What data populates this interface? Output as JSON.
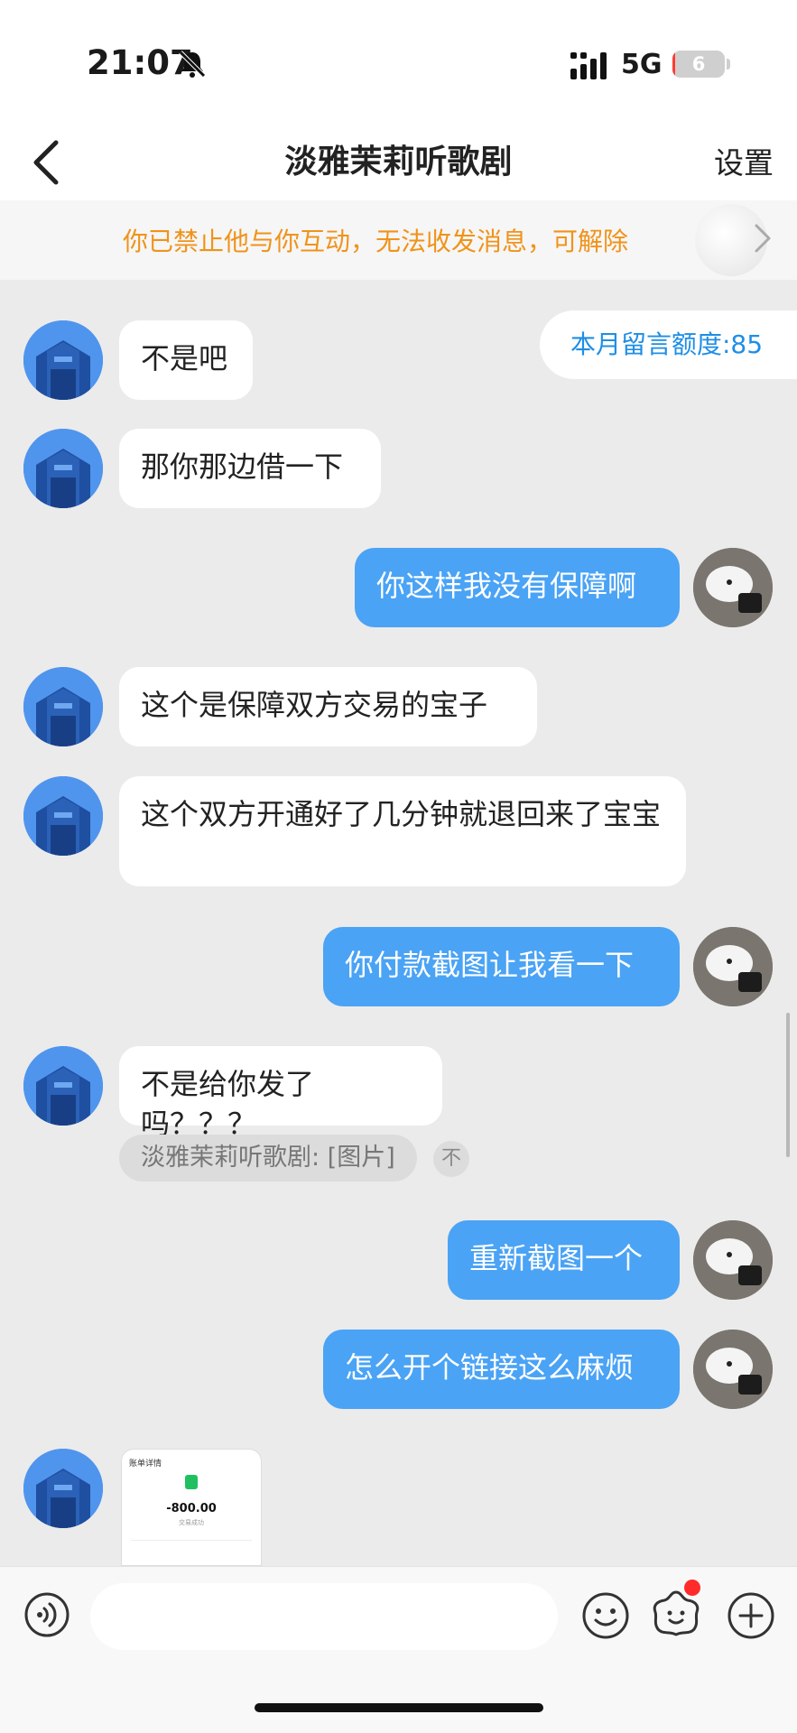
{
  "status_bar": {
    "time": "21:07",
    "network": "5G",
    "battery_level": "6",
    "battery_fraction": 0.06
  },
  "nav": {
    "title": "淡雅茉莉听歌剧",
    "settings_label": "设置"
  },
  "banner": {
    "text": "你已禁止他与你互动，无法收发消息，可解除"
  },
  "quota": {
    "text": "本月留言额度:85"
  },
  "messages": [
    {
      "from": "them",
      "text": "不是吧"
    },
    {
      "from": "them",
      "text": "那你那边借一下"
    },
    {
      "from": "me",
      "text": "你这样我没有保障啊"
    },
    {
      "from": "them",
      "text": "这个是保障双方交易的宝子"
    },
    {
      "from": "them",
      "text": "这个双方开通好了几分钟就退回来了宝宝"
    },
    {
      "from": "me",
      "text": "你付款截图让我看一下"
    },
    {
      "from": "them",
      "text": "不是给你发了吗？？？"
    },
    {
      "from": "me",
      "text": "重新截图一个"
    },
    {
      "from": "me",
      "text": "怎么开个链接这么麻烦"
    }
  ],
  "system_notice": {
    "text": "淡雅茉莉听歌剧: [图片]",
    "translate_glyph": "不"
  },
  "image_message": {
    "header": "账单详情",
    "amount": "-800.00",
    "status": "交易成功"
  },
  "input": {
    "placeholder": ""
  },
  "colors": {
    "accent": "#4aa3f5",
    "banner_text": "#f0931a",
    "quota_text": "#1e8ee6"
  }
}
